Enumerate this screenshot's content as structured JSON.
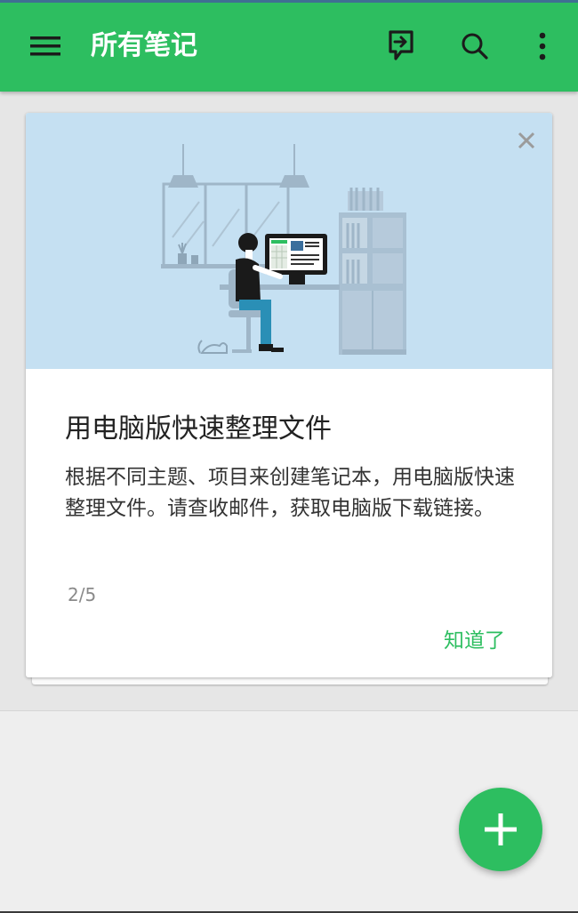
{
  "appbar": {
    "title": "所有笔记",
    "icons": {
      "menu": "hamburger-menu-icon",
      "share": "share-to-desktop-icon",
      "search": "search-icon",
      "more": "more-vert-icon"
    },
    "color": "#2dbe60"
  },
  "tip_card": {
    "title": "用电脑版快速整理文件",
    "body": "根据不同主题、项目来创建笔记本，用电脑版快速整理文件。请查收邮件，获取电脑版下载链接。",
    "pager": "2/5",
    "action_label": "知道了",
    "close_icon": "close-icon",
    "illustration": "person-at-desktop-computer-illustration",
    "illustration_bg": "#c5e0f2"
  },
  "fab": {
    "icon": "plus-icon",
    "color": "#2dbe60"
  }
}
